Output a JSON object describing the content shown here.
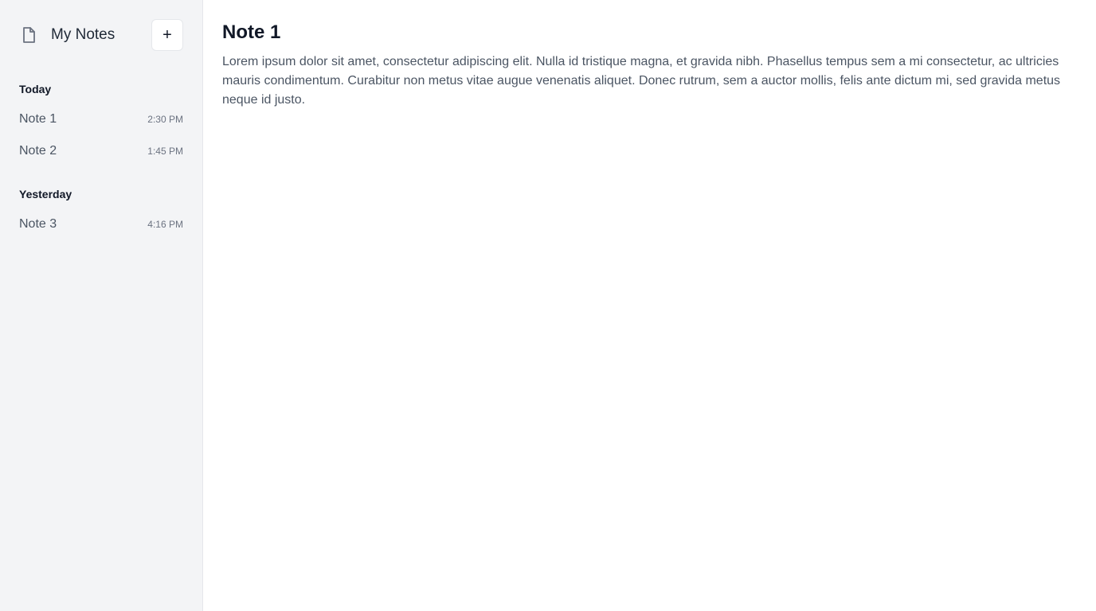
{
  "sidebar": {
    "title": "My Notes",
    "brand_icon": "document-icon",
    "add_button_label": "+",
    "groups": [
      {
        "label": "Today",
        "notes": [
          {
            "title": "Note 1",
            "time": "2:30 PM"
          },
          {
            "title": "Note 2",
            "time": "1:45 PM"
          }
        ]
      },
      {
        "label": "Yesterday",
        "notes": [
          {
            "title": "Note 3",
            "time": "4:16 PM"
          }
        ]
      }
    ]
  },
  "main": {
    "title": "Note 1",
    "body": "Lorem ipsum dolor sit amet, consectetur adipiscing elit. Nulla id tristique magna, et gravida nibh. Phasellus tempus sem a mi consectetur, ac ultricies mauris condimentum. Curabitur non metus vitae augue venenatis aliquet. Donec rutrum, sem a auctor mollis, felis ante dictum mi, sed gravida metus neque id justo."
  },
  "colors": {
    "sidebar_bg": "#f3f4f6",
    "text_primary": "#111827",
    "text_secondary": "#4b5563",
    "text_muted": "#6b7280",
    "border": "#e5e7eb"
  }
}
